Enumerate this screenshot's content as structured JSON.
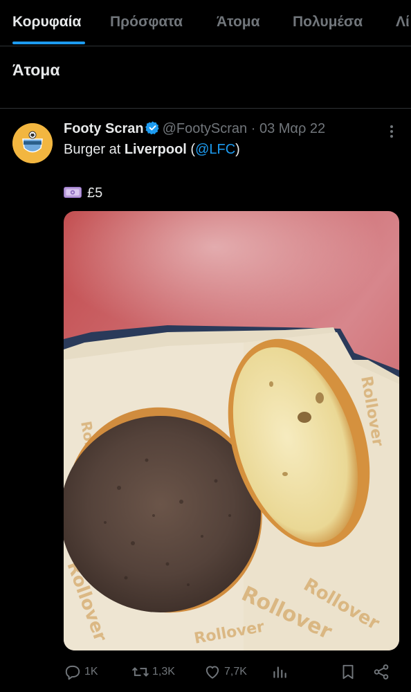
{
  "tabs": [
    {
      "label": "Κορυφαία",
      "active": true
    },
    {
      "label": "Πρόσφατα",
      "active": false
    },
    {
      "label": "Άτομα",
      "active": false
    },
    {
      "label": "Πολυμέσα",
      "active": false
    },
    {
      "label": "Λί",
      "active": false
    }
  ],
  "section": {
    "title": "Άτομα"
  },
  "tweet": {
    "author_name": "Footy Scran",
    "handle": "@FootyScran",
    "separator": "·",
    "date": "03 Μαρ 22",
    "text_prefix": "Burger at ",
    "text_bold": "Liverpool",
    "text_open": " (",
    "mention": "@LFC",
    "text_close": ")",
    "price": "£5",
    "price_icon": "money-icon",
    "media_alt": "Burger with patty and bun in Rollover paper tray"
  },
  "actions": {
    "replies": "1K",
    "retweets": "1,3K",
    "likes": "7,7K"
  },
  "colors": {
    "accent": "#1d9bf0",
    "background": "#000000",
    "text": "#e7e9ea",
    "muted": "#71767b",
    "divider": "#2f3336"
  }
}
